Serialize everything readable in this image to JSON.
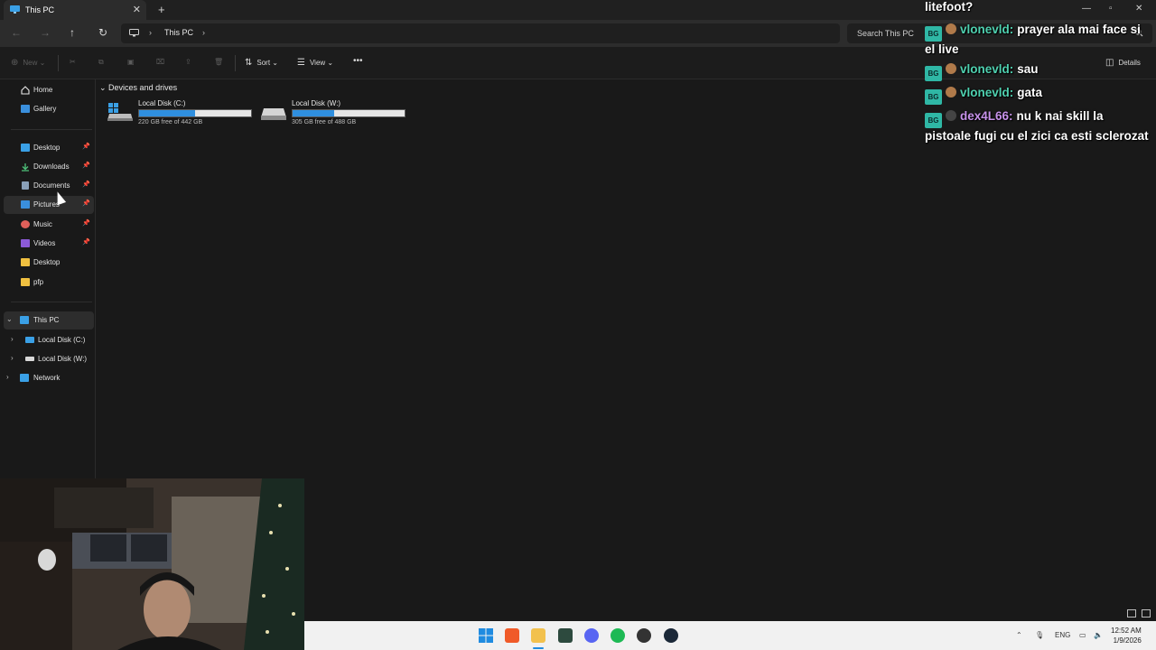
{
  "window": {
    "tab_title": "This PC",
    "close_tab": "✕",
    "new_tab": "+"
  },
  "address": {
    "crumb": "This PC",
    "search_placeholder": "Search This PC"
  },
  "commands": {
    "new": "New",
    "sort": "Sort",
    "view": "View",
    "more": "•••",
    "details": "Details"
  },
  "sidebar": {
    "top": [
      {
        "label": "Home",
        "icon": "home-icon",
        "color": "#e8e8e8"
      },
      {
        "label": "Gallery",
        "icon": "gallery-icon",
        "color": "#3a8fdc"
      }
    ],
    "pinned": [
      {
        "label": "Desktop",
        "icon": "desktop-folder-icon",
        "color": "#3aa0e6",
        "pinned": true
      },
      {
        "label": "Downloads",
        "icon": "download-icon",
        "color": "#4ec27a",
        "pinned": true
      },
      {
        "label": "Documents",
        "icon": "documents-icon",
        "color": "#8aa0b8",
        "pinned": true
      },
      {
        "label": "Pictures",
        "icon": "pictures-icon",
        "color": "#3a8fdc",
        "pinned": true
      },
      {
        "label": "Music",
        "icon": "music-icon",
        "color": "#e0605a",
        "pinned": true
      },
      {
        "label": "Videos",
        "icon": "videos-icon",
        "color": "#8c5ad8",
        "pinned": true
      },
      {
        "label": "Desktop",
        "icon": "folder-icon",
        "color": "#f0c040",
        "pinned": false
      },
      {
        "label": "pfp",
        "icon": "folder-icon",
        "color": "#f0c040",
        "pinned": false
      }
    ],
    "tree": [
      {
        "label": "This PC",
        "icon": "this-pc-icon",
        "color": "#3aa0e6",
        "expanded": true
      },
      {
        "label": "Local Disk (C:)",
        "icon": "drive-c-icon",
        "color": "#3aa0e6"
      },
      {
        "label": "Local Disk (W:)",
        "icon": "drive-w-icon",
        "color": "#d8d8d8"
      },
      {
        "label": "Network",
        "icon": "network-icon",
        "color": "#3aa0e6"
      }
    ]
  },
  "content": {
    "section_title": "Devices and drives",
    "drives": [
      {
        "name": "Local Disk (C:)",
        "free_text": "220 GB free of 442 GB",
        "used_fraction": 0.5
      },
      {
        "name": "Local Disk (W:)",
        "free_text": "305 GB free of 488 GB",
        "used_fraction": 0.37
      }
    ]
  },
  "chat": [
    {
      "user": "",
      "message": "litefoot?"
    },
    {
      "user": "vlonevld:",
      "user_color": "#4fd1b0",
      "message": "prayer ala mai face si el live"
    },
    {
      "user": "vlonevld:",
      "user_color": "#4fd1b0",
      "message": "sau"
    },
    {
      "user": "vlonevld:",
      "user_color": "#4fd1b0",
      "message": "gata"
    },
    {
      "user": "dex4L66:",
      "user_color": "#c792ea",
      "message": "nu k nai skill la pistoale fugi cu el zici ca esti sclerozat"
    }
  ],
  "chat_badge": "BG",
  "taskbar": {
    "language": "ENG",
    "time": "12:52 AM",
    "date": "1/9/2026"
  },
  "colors": {
    "accent": "#2f8fdf",
    "background": "#191919"
  }
}
